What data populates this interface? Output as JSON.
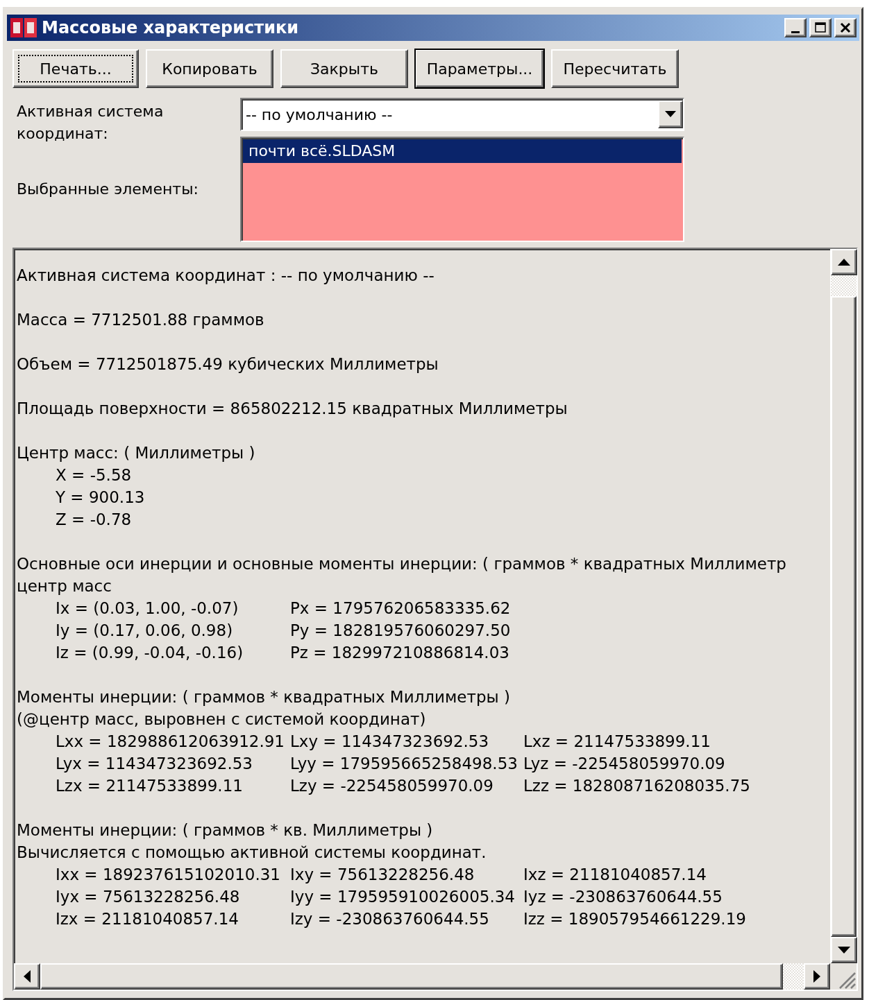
{
  "window": {
    "title": "Массовые характеристики"
  },
  "buttons": [
    {
      "label": "Печать...",
      "focused": true,
      "default": false
    },
    {
      "label": "Копировать",
      "focused": false,
      "default": false
    },
    {
      "label": "Закрыть",
      "focused": false,
      "default": false
    },
    {
      "label": "Параметры...",
      "focused": false,
      "default": true
    },
    {
      "label": "Пересчитать",
      "focused": false,
      "default": false
    }
  ],
  "coordinate_system": {
    "label": "Активная система координат:",
    "value": "-- по умолчанию --"
  },
  "selected_items": {
    "label": "Выбранные элементы:",
    "items": [
      {
        "text": "почти всё.SLDASM",
        "selected": true
      }
    ]
  },
  "report": [
    {
      "lines": [
        "Активная система координат : -- по умолчанию --"
      ]
    },
    {
      "lines": [
        "Масса = 7712501.88 граммов"
      ]
    },
    {
      "lines": [
        "Объем = 7712501875.49 кубических Миллиметры"
      ]
    },
    {
      "lines": [
        "Площадь поверхности = 865802212.15 квадратных Миллиметры"
      ]
    },
    {
      "lines": [
        "Центр масс: ( Миллиметры )"
      ],
      "rows": [
        [
          "X = -5.58"
        ],
        [
          "Y = 900.13"
        ],
        [
          "Z = -0.78"
        ]
      ]
    },
    {
      "lines": [
        "Основные оси инерции и основные моменты инерции: ( граммов * квадратных Миллиметр",
        "центр масс"
      ],
      "rows": [
        [
          "Ix = (0.03, 1.00, -0.07)",
          "Px = 179576206583335.62"
        ],
        [
          "Iy = (0.17, 0.06, 0.98)",
          "Py = 182819576060297.50"
        ],
        [
          "Iz = (0.99, -0.04, -0.16)",
          "Pz = 182997210886814.03"
        ]
      ]
    },
    {
      "lines": [
        "Моменты инерции: ( граммов * квадратных Миллиметры )",
        "(@центр масс, выровнен с системой координат)"
      ],
      "rows": [
        [
          "Lxx = 182988612063912.91",
          "Lxy = 114347323692.53",
          "Lxz = 21147533899.11"
        ],
        [
          "Lyx = 114347323692.53",
          "Lyy = 179595665258498.53",
          "Lyz = -225458059970.09"
        ],
        [
          "Lzx = 21147533899.11",
          "Lzy = -225458059970.09",
          "Lzz = 182808716208035.75"
        ]
      ]
    },
    {
      "lines": [
        "Моменты инерции: ( граммов * кв. Миллиметры )",
        "Вычисляется с помощью активной системы координат."
      ],
      "rows": [
        [
          "Ixx = 189237615102010.31",
          "Ixy = 75613228256.48",
          "Ixz = 21181040857.14"
        ],
        [
          "Iyx = 75613228256.48",
          "Iyy = 179595910026005.34",
          "Iyz = -230863760644.55"
        ],
        [
          "Izx = 21181040857.14",
          "Izy = -230863760644.55",
          "Izz = 189057954661229.19"
        ]
      ]
    }
  ]
}
